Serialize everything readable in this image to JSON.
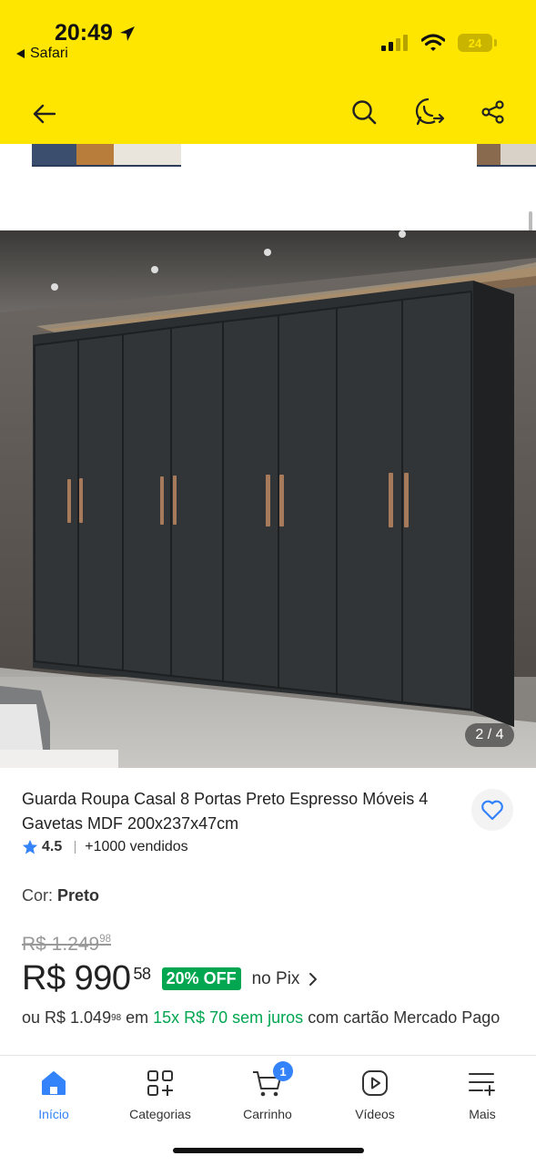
{
  "status_bar": {
    "time": "20:49",
    "back_app": "Safari",
    "battery": "24"
  },
  "product": {
    "title": "Guarda Roupa Casal 8 Portas Preto Espresso Móveis 4 Gavetas MDF 200x237x47cm",
    "rating": "4.5",
    "sold": "+1000 vendidos",
    "image_counter": "2 / 4",
    "color_label": "Cor:",
    "color_value": "Preto",
    "old_price_main": "R$ 1.249",
    "old_price_cents": "98",
    "price_main": "R$ 990",
    "price_cents": "58",
    "discount": "20% OFF",
    "pix_label": "no Pix",
    "installment_prefix": "ou R$ 1.049",
    "installment_prefix_cents": "98",
    "installment_em": "em",
    "installment_plan": "15x R$ 70 sem juros",
    "installment_suffix": "com cartão Mercado Pago"
  },
  "tabs": [
    {
      "label": "Início",
      "icon": "home-icon",
      "active": true
    },
    {
      "label": "Categorias",
      "icon": "categories-icon"
    },
    {
      "label": "Carrinho",
      "icon": "cart-icon",
      "badge": "1"
    },
    {
      "label": "Vídeos",
      "icon": "video-icon"
    },
    {
      "label": "Mais",
      "icon": "menu-plus-icon"
    }
  ],
  "colors": {
    "brand_yellow": "#FFE600",
    "accent_blue": "#3483FA",
    "green": "#00A650"
  }
}
